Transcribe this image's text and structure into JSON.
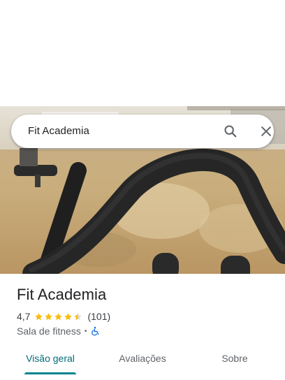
{
  "search": {
    "query": "Fit Academia"
  },
  "place": {
    "name": "Fit Academia",
    "rating": "4,7",
    "stars": 4.5,
    "reviews": "(101)",
    "category": "Sala de fitness",
    "separator": "•"
  },
  "tabs": [
    {
      "label": "Visão geral",
      "active": true
    },
    {
      "label": "Avaliações",
      "active": false
    },
    {
      "label": "Sobre",
      "active": false
    }
  ],
  "colors": {
    "accent": "#00838f",
    "star": "#fbbc04",
    "accessibility": "#1a73e8"
  },
  "icons": [
    "search-icon",
    "close-icon",
    "star-icon",
    "accessibility-icon"
  ]
}
